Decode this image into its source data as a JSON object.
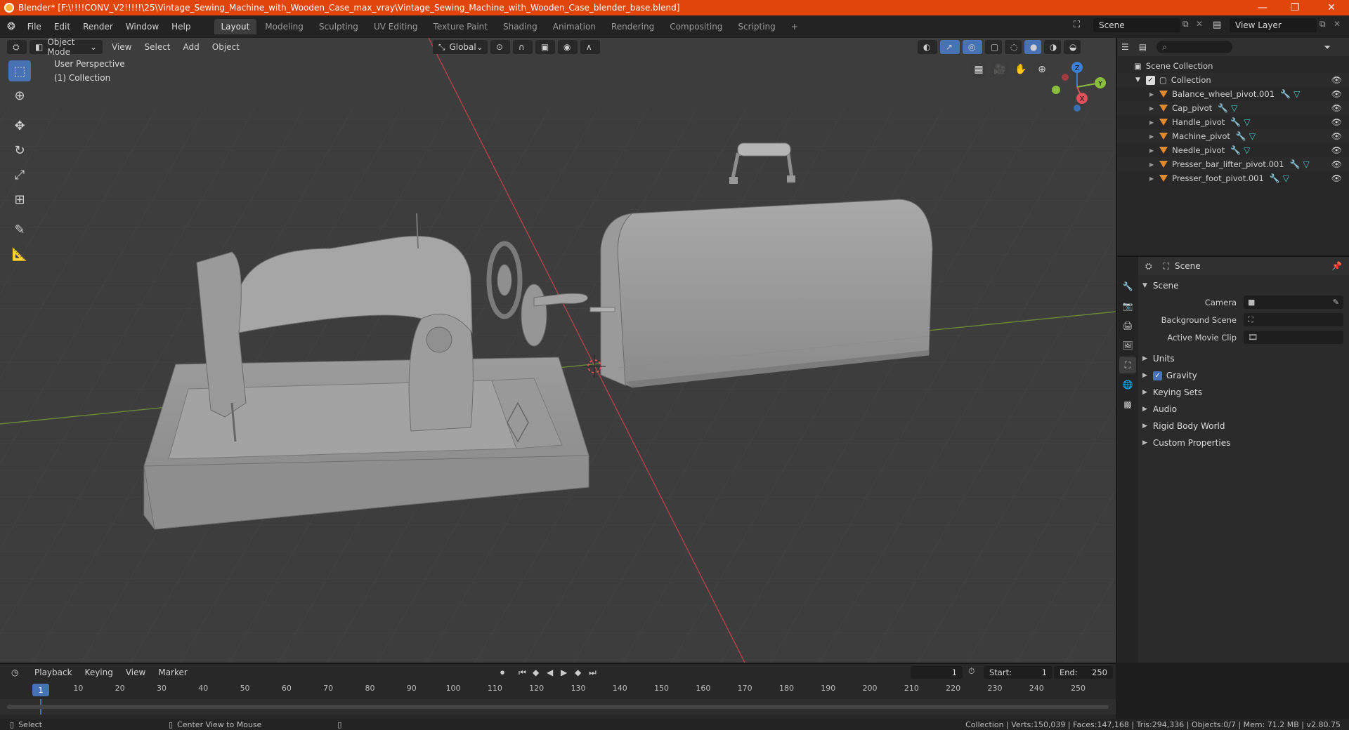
{
  "window": {
    "title": "Blender* [F:\\!!!!CONV_V2!!!!!\\25\\Vintage_Sewing_Machine_with_Wooden_Case_max_vray\\Vintage_Sewing_Machine_with_Wooden_Case_blender_base.blend]",
    "minimize": "—",
    "maximize": "❐",
    "close": "✕"
  },
  "menus": [
    "File",
    "Edit",
    "Render",
    "Window",
    "Help"
  ],
  "workspaces": [
    "Layout",
    "Modeling",
    "Sculpting",
    "UV Editing",
    "Texture Paint",
    "Shading",
    "Animation",
    "Rendering",
    "Compositing",
    "Scripting"
  ],
  "workspace_add": "+",
  "scene_field": "Scene",
  "view_layer_field": "View Layer",
  "viewport": {
    "mode": "Object Mode",
    "menus": [
      "View",
      "Select",
      "Add",
      "Object"
    ],
    "orientation": "Global",
    "perspective_label": "User Perspective",
    "collection_label": "(1) Collection",
    "gizmo": {
      "z": "Z",
      "y": "Y",
      "x": "X"
    }
  },
  "outliner": {
    "root": "Scene Collection",
    "collection": "Collection",
    "items": [
      "Balance_wheel_pivot.001",
      "Cap_pivot",
      "Handle_pivot",
      "Machine_pivot",
      "Needle_pivot",
      "Presser_bar_lifter_pivot.001",
      "Presser_foot_pivot.001"
    ]
  },
  "properties": {
    "context": "Scene",
    "panel": "Scene",
    "rows": [
      {
        "label": "Camera"
      },
      {
        "label": "Background Scene"
      },
      {
        "label": "Active Movie Clip"
      }
    ],
    "subpanels": [
      "Units",
      "Gravity",
      "Keying Sets",
      "Audio",
      "Rigid Body World",
      "Custom Properties"
    ]
  },
  "timeline": {
    "menus": [
      "Playback",
      "Keying",
      "View",
      "Marker"
    ],
    "current_frame": "1",
    "start_label": "Start:",
    "start": "1",
    "end_label": "End:",
    "end": "250",
    "ticks": [
      "1",
      "10",
      "20",
      "30",
      "40",
      "50",
      "60",
      "70",
      "80",
      "90",
      "100",
      "110",
      "120",
      "130",
      "140",
      "150",
      "160",
      "170",
      "180",
      "190",
      "200",
      "210",
      "220",
      "230",
      "240",
      "250"
    ]
  },
  "status": {
    "left_action": "Select",
    "middle_action": "Center View to Mouse",
    "stats": "Collection | Verts:150,039 | Faces:147,168 | Tris:294,336 | Objects:0/7 | Mem: 71.2 MB | v2.80.75"
  },
  "colors": {
    "title_bar": "#e1450a",
    "accent": "#4772b3",
    "x_axis": "#e0505a",
    "y_axis": "#8bbd3c",
    "z_axis": "#3b7fd6",
    "object_tri": "#e3892d"
  }
}
